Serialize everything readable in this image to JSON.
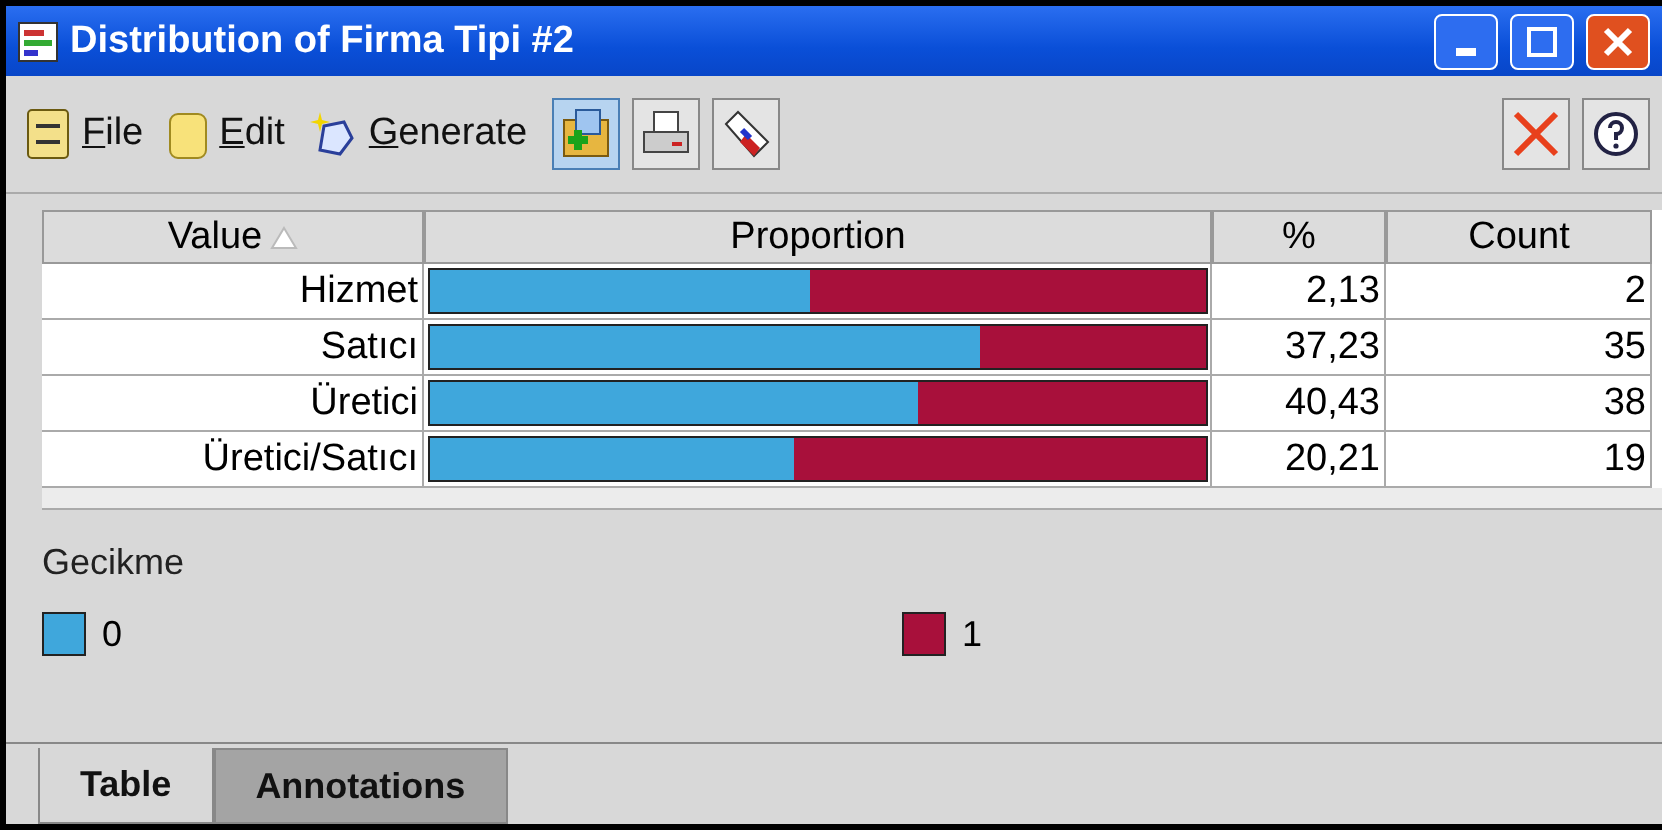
{
  "window": {
    "title": "Distribution of Firma Tipi #2"
  },
  "menu": [
    {
      "label": "File",
      "kind": "file"
    },
    {
      "label": "Edit",
      "kind": "edit"
    },
    {
      "label": "Generate",
      "kind": "generate"
    }
  ],
  "table": {
    "columns": [
      "Value",
      "Proportion",
      "%",
      "Count"
    ],
    "rows": [
      {
        "value": "Hizmet",
        "level": 0.49,
        "percent": "2,13",
        "count": "2"
      },
      {
        "value": "Satıcı",
        "level": 0.71,
        "percent": "37,23",
        "count": "35"
      },
      {
        "value": "Üretici",
        "level": 0.63,
        "percent": "40,43",
        "count": "38"
      },
      {
        "value": "Üretici/Satıcı",
        "level": 0.47,
        "percent": "20,21",
        "count": "19"
      }
    ]
  },
  "legend": {
    "title": "Gecikme",
    "items": [
      {
        "label": "0",
        "color": "#3fa7dc"
      },
      {
        "label": "1",
        "color": "#a8103b"
      }
    ]
  },
  "tabs": [
    {
      "label": "Table",
      "selected": true
    },
    {
      "label": "Annotations",
      "selected": false
    }
  ]
}
